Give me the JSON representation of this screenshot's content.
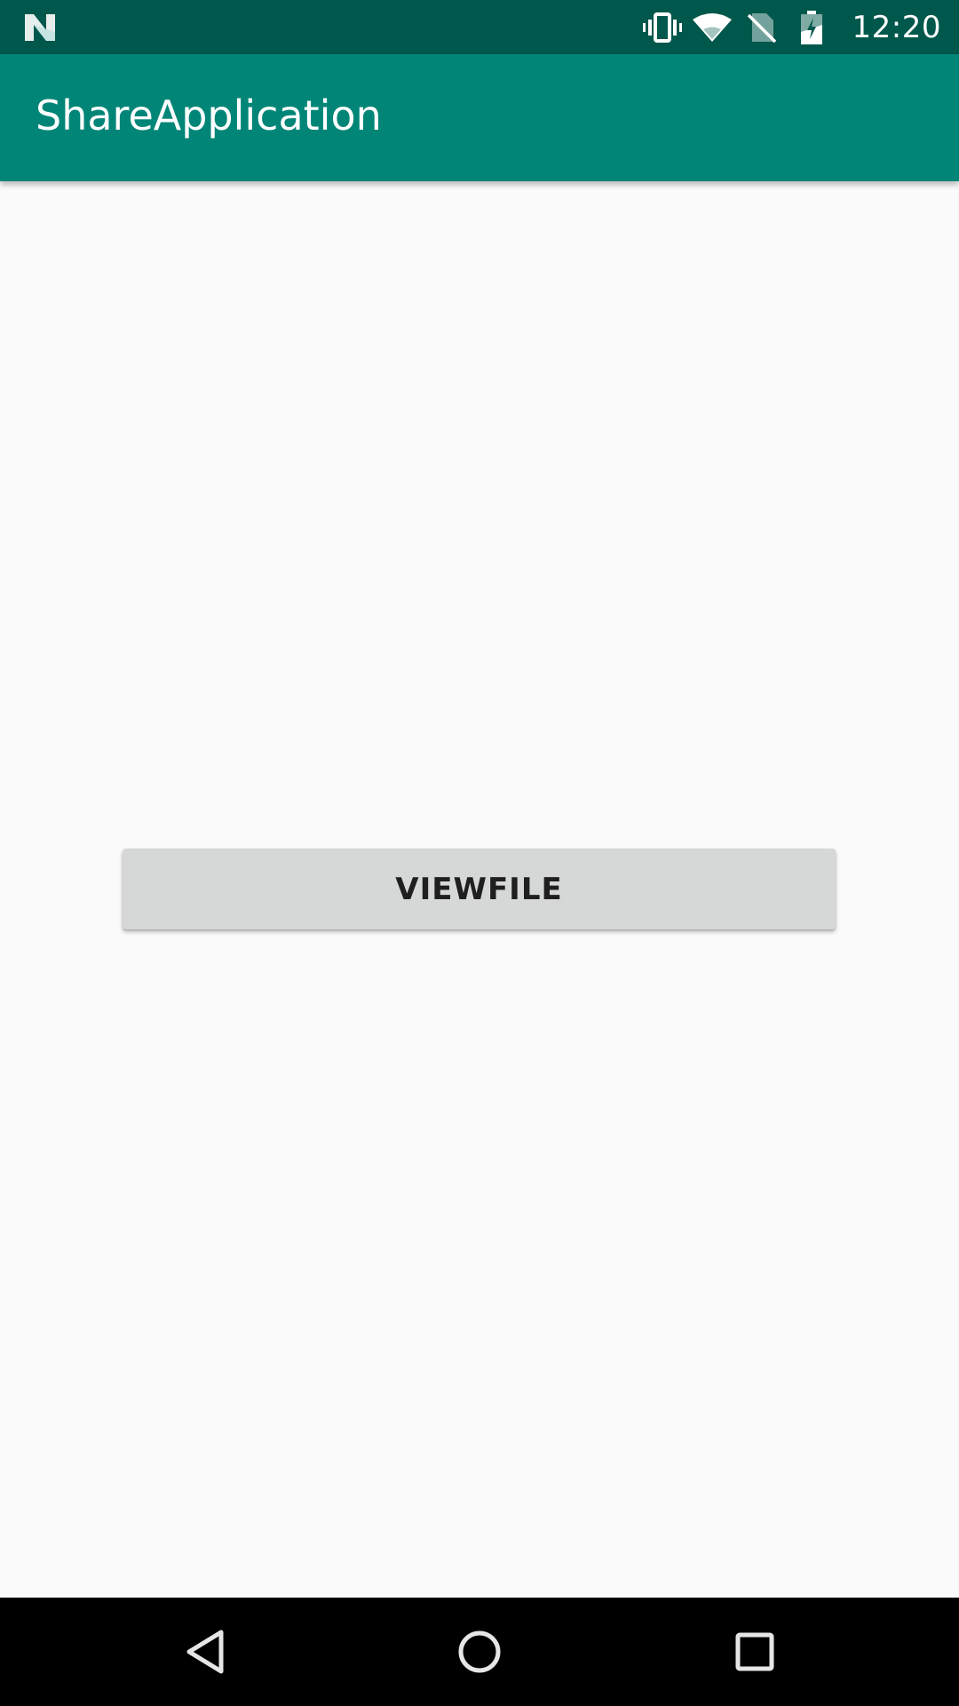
{
  "status_bar": {
    "time": "12:20",
    "icons": [
      "android-n-icon",
      "vibrate-icon",
      "wifi-icon",
      "no-sim-icon",
      "battery-charging-icon"
    ]
  },
  "app_bar": {
    "title": "ShareApplication"
  },
  "main": {
    "view_file_button_label": "VIEWFILE"
  },
  "nav_bar": {
    "buttons": [
      "back-icon",
      "home-icon",
      "recents-icon"
    ]
  },
  "colors": {
    "status_bar": "#00574b",
    "app_bar": "#008577",
    "background": "#fafafa",
    "button": "#d6d7d7",
    "nav_bar": "#000000"
  }
}
